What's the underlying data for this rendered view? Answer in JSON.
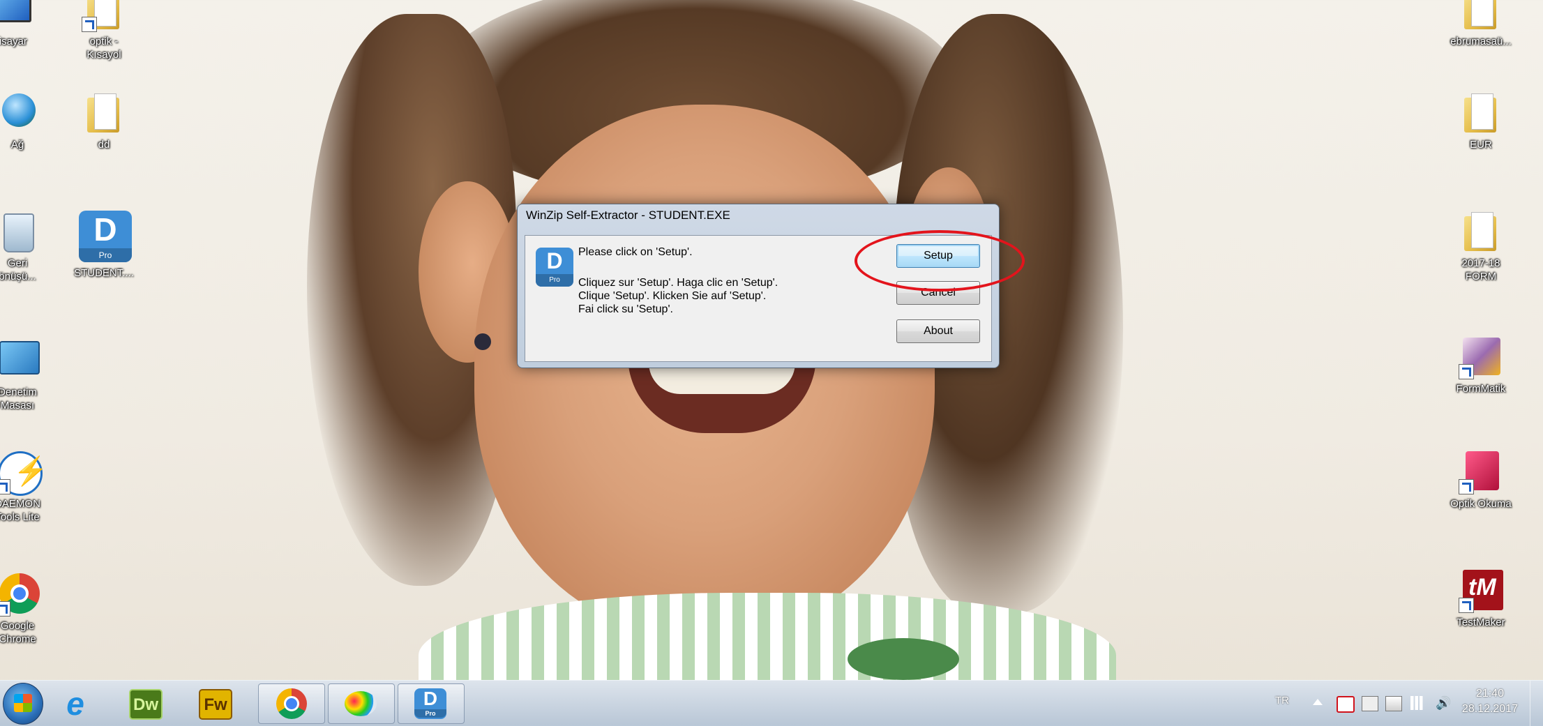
{
  "desktop": {
    "icons_left_col1": [
      {
        "label": "lgisayar",
        "icon": "computer-icon"
      },
      {
        "label": "Ağ",
        "icon": "network-icon"
      },
      {
        "label": "Geri\nönüşü...",
        "icon": "recycle-bin-icon"
      },
      {
        "label": "Denetim\nMasası",
        "icon": "control-panel-icon"
      },
      {
        "label": "DAEMON\nTools Lite",
        "icon": "daemon-tools-icon"
      },
      {
        "label": "Google\nChrome",
        "icon": "chrome-icon"
      }
    ],
    "icons_left_col2": [
      {
        "label": "optik -\nKısayol",
        "icon": "folder-shortcut-icon"
      },
      {
        "label": "dd",
        "icon": "folder-icon"
      },
      {
        "label": "STUDENT....",
        "icon": "student-pro-icon"
      }
    ],
    "icons_right": [
      {
        "label": "ebrumasaü...",
        "icon": "folder-icon"
      },
      {
        "label": "EUR",
        "icon": "folder-icon"
      },
      {
        "label": "2017-18\nFORM",
        "icon": "folder-icon"
      },
      {
        "label": "FormMatik",
        "icon": "formmatik-icon"
      },
      {
        "label": "Optik Okuma",
        "icon": "optik-okuma-icon"
      },
      {
        "label": "TestMaker",
        "icon": "testmaker-icon"
      }
    ]
  },
  "dialog": {
    "title": "WinZip Self-Extractor - STUDENT.EXE",
    "message": "Please click on 'Setup'.",
    "message_multilang": [
      "Cliquez sur 'Setup'.  Haga clic en 'Setup'.",
      "Clique 'Setup'.  Klicken Sie auf 'Setup'.",
      "Fai click su 'Setup'."
    ],
    "app_icon_letter": "D",
    "app_icon_sub": "Pro",
    "buttons": {
      "setup": "Setup",
      "cancel": "Cancel",
      "about": "About"
    }
  },
  "taskbar": {
    "items": [
      {
        "name": "internet-explorer",
        "glyph": "e"
      },
      {
        "name": "dreamweaver",
        "glyph": "Dw"
      },
      {
        "name": "fireworks",
        "glyph": "Fw"
      },
      {
        "name": "chrome",
        "glyph": ""
      },
      {
        "name": "paint",
        "glyph": ""
      },
      {
        "name": "student-pro",
        "glyph": "D",
        "sub": "Pro"
      }
    ],
    "tray": {
      "language": "TR",
      "time": "21:40",
      "date": "28.12.2017"
    }
  },
  "colors": {
    "highlight_ring": "#e3141c",
    "app_blue": "#3e8ed6",
    "dw_green": "#4a7a1a",
    "fw_yellow": "#e1b400"
  }
}
